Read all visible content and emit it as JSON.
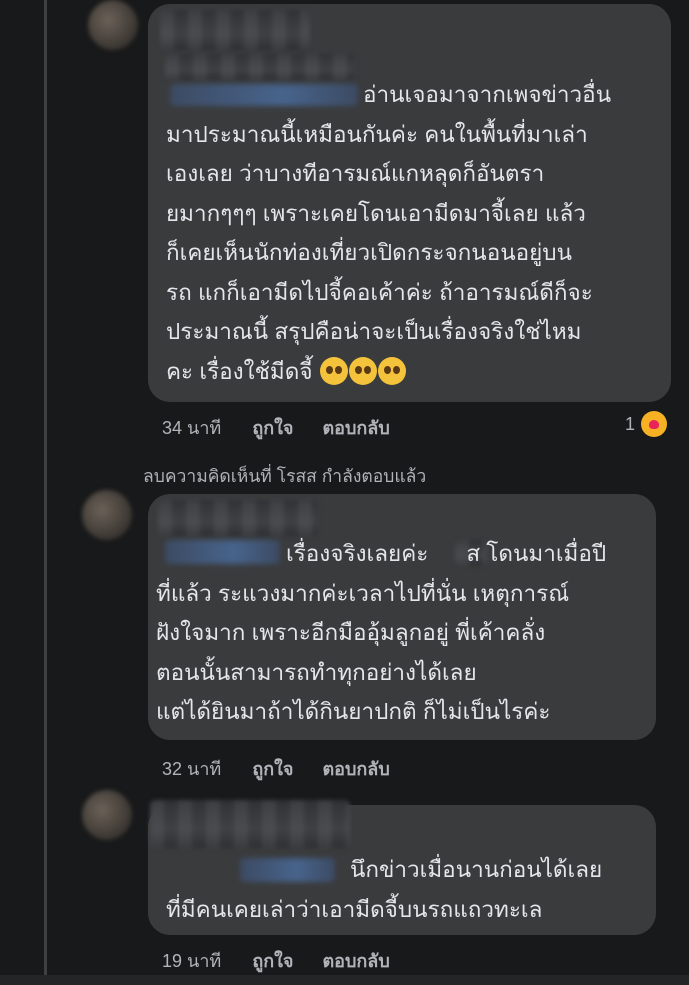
{
  "comments": [
    {
      "lines": [
        "อ่านเจอมาจากเพจข่าวอื่น",
        "มาประมาณนี้เหมือนกันค่ะ คนในพื้นที่มาเล่า",
        "เองเลย ว่าบางทีอารมณ์แกหลุดก็อันตรา",
        "ยมากๆๆๆ เพราะเคยโดนเอามีดมาจี้เลย แล้ว",
        "ก็เคยเห็นนักท่องเที่ยวเปิดกระจกนอนอยู่บน",
        "รถ แกก็เอามีดไปจี้คอเค้าค่ะ  ถ้าอารมณ์ดีก็จะ",
        "ประมาณนี้ สรุปคือน่าจะเป็นเรื่องจริงใช่ไหม",
        "คะ เรื่องใช้มีดจี้"
      ],
      "emoji_icons": [
        "pleading-face",
        "pleading-face",
        "pleading-face"
      ],
      "time": "34 นาที",
      "like": "ถูกใจ",
      "reply": "ตอบกลับ",
      "reaction_count": "1",
      "reaction_icon": "care-reaction"
    },
    {
      "lines": [
        "เรื่องจริงเลยค่ะ",
        "ส โดนมาเมื่อปี",
        "ที่แล้ว ระแวงมากค่ะเวลาไปที่นั่น เหตุการณ์",
        "ฝังใจมาก เพราะอีกมืออุ้มลูกอยู่ พี่เค้าคลั่ง",
        "ตอนนั้นสามารถทำทุกอย่างได้เลย",
        "แต่ได้ยินมาถ้าได้กินยาปกติ ก็ไม่เป็นไรค่ะ"
      ],
      "time": "32 นาที",
      "like": "ถูกใจ",
      "reply": "ตอบกลับ"
    },
    {
      "lines": [
        "นึกข่าวเมื่อนานก่อนได้เลย",
        "ที่มีคนเคยเล่าว่าเอามีดจี้บนรถแถวทะเล"
      ],
      "time": "19 นาที",
      "like": "ถูกใจ",
      "reply": "ตอบกลับ"
    }
  ],
  "deleted_notice": "ลบความคิดเห็นที่ โรสส กำลังตอบแล้ว"
}
